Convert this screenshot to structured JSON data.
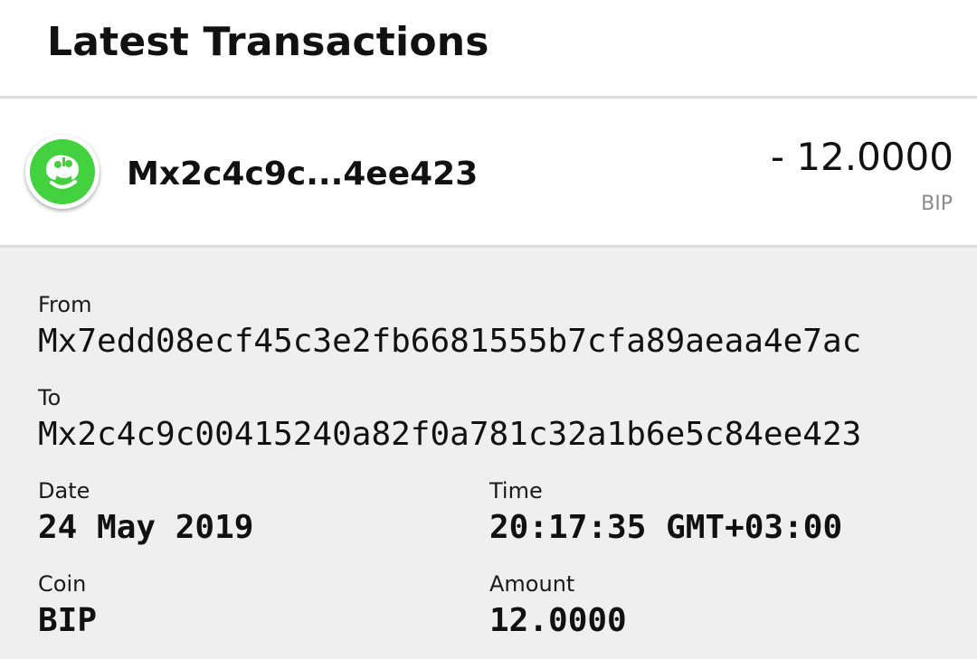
{
  "header": {
    "title": "Latest Transactions"
  },
  "transaction": {
    "avatar_icon": "minter-avatar-icon",
    "avatar_color": "#44d140",
    "short_address": "Mx2c4c9c...4ee423",
    "amount": "- 12.0000",
    "coin": "BIP"
  },
  "details": {
    "from_label": "From",
    "from_value": "Mx7edd08ecf45c3e2fb6681555b7cfa89aeaa4e7ac",
    "to_label": "To",
    "to_value": "Mx2c4c9c00415240a82f0a781c32a1b6e5c84ee423",
    "date_label": "Date",
    "date_value": "24 May 2019",
    "time_label": "Time",
    "time_value": "20:17:35 GMT+03:00",
    "coin_label": "Coin",
    "coin_value": "BIP",
    "amount_label": "Amount",
    "amount_value": "12.0000"
  }
}
